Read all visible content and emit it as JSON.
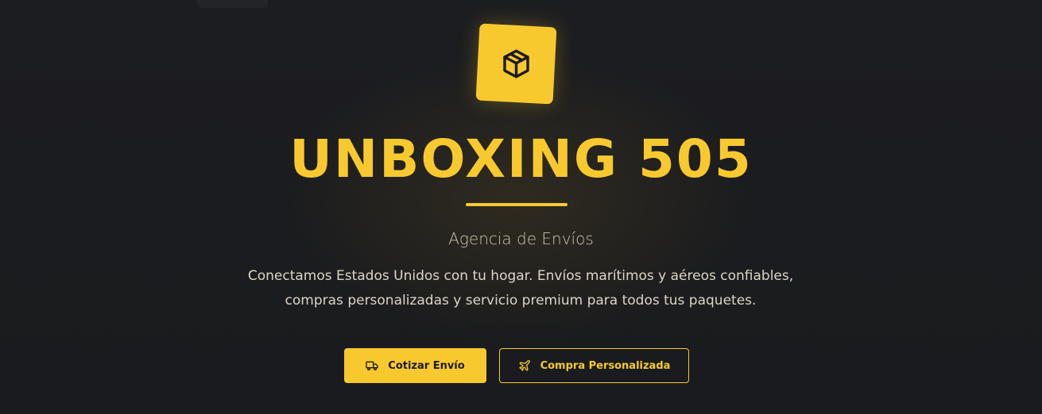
{
  "hero": {
    "logo_icon": "package-icon",
    "title": "UNBOXING 505",
    "subtitle": "Agencia de Envíos",
    "description_line1": "Conectamos Estados Unidos con tu hogar. Envíos marítimos y aéreos confiables,",
    "description_line2": "compras personalizadas y servicio premium para todos tus paquetes."
  },
  "buttons": {
    "primary": {
      "label": "Cotizar Envío",
      "icon": "truck-icon"
    },
    "secondary": {
      "label": "Compra Personalizada",
      "icon": "plane-icon"
    }
  },
  "colors": {
    "accent": "#f8c92f",
    "background": "#1b1c1f",
    "text": "#dcd6c6"
  }
}
